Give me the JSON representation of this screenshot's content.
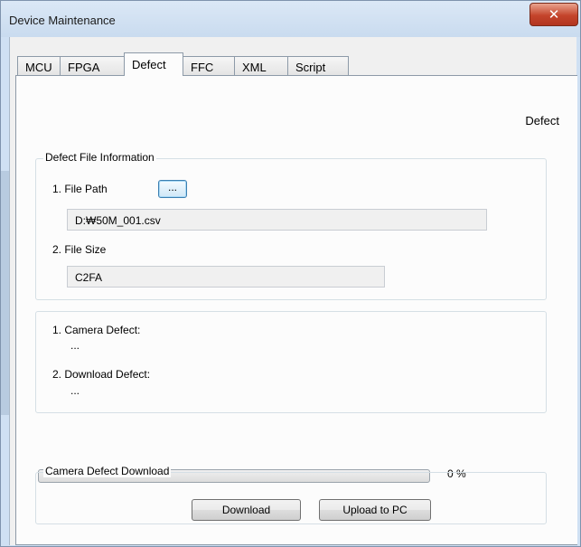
{
  "window": {
    "title": "Device Maintenance",
    "close_symbol": "✕"
  },
  "tabs": [
    {
      "label": "MCU",
      "active": false
    },
    {
      "label": "FPGA",
      "active": false
    },
    {
      "label": "Defect",
      "active": true
    },
    {
      "label": "FFC",
      "active": false
    },
    {
      "label": "XML",
      "active": false
    },
    {
      "label": "Script",
      "active": false
    }
  ],
  "panel": {
    "heading": "Defect"
  },
  "file_info": {
    "group_title": "Defect File Information",
    "file_path_label": "1. File Path",
    "browse_label": "...",
    "file_path_value": "D:₩50M_001.csv",
    "file_size_label": "2. File Size",
    "file_size_value": "C2FA"
  },
  "defect_info": {
    "camera_defect_label": "1. Camera Defect:",
    "camera_defect_value": "...",
    "download_defect_label": "2. Download Defect:",
    "download_defect_value": "..."
  },
  "progress": {
    "percent": 0,
    "text": "0 %"
  },
  "download": {
    "group_title": "Camera Defect Download",
    "download_label": "Download",
    "upload_label": "Upload to PC"
  },
  "colors": {
    "close_button": "#c4442b",
    "title_bar": "#cfe0f3",
    "panel_bg": "#fcfcfc"
  }
}
